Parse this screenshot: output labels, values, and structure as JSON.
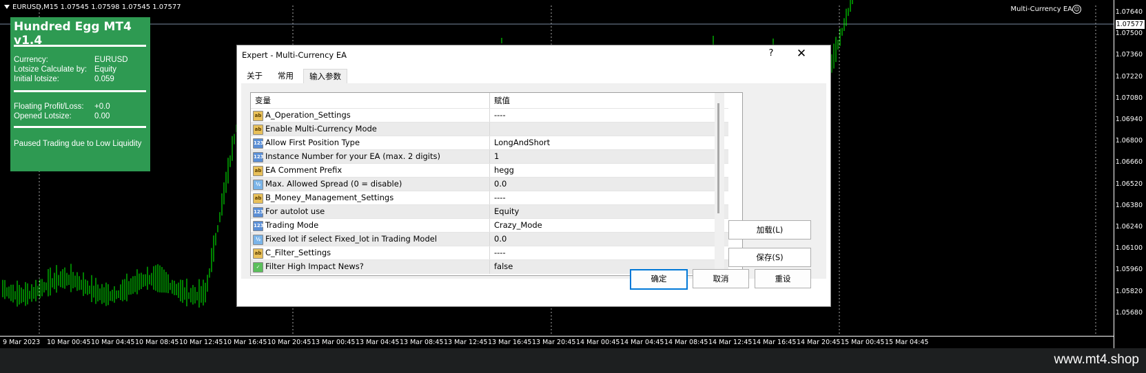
{
  "chart": {
    "symbol_line": "EURUSD,M15  1.07545 1.07598 1.07545 1.07577",
    "ea_name": "Multi-Currency EA",
    "smiley_icon": "☺",
    "price_ticks": [
      "1.07640",
      "1.07500",
      "1.07360",
      "1.07220",
      "1.07080",
      "1.06940",
      "1.06800",
      "1.06660",
      "1.06520",
      "1.06380",
      "1.06240",
      "1.06100",
      "1.05960",
      "1.05820",
      "1.05680"
    ],
    "current_price": "1.07577",
    "time_ticks": [
      "9 Mar 2023",
      "10 Mar 00:45",
      "10 Mar 04:45",
      "10 Mar 08:45",
      "10 Mar 12:45",
      "10 Mar 16:45",
      "10 Mar 20:45",
      "13 Mar 00:45",
      "13 Mar 04:45",
      "13 Mar 08:45",
      "13 Mar 12:45",
      "13 Mar 16:45",
      "13 Mar 20:45",
      "14 Mar 00:45",
      "14 Mar 04:45",
      "14 Mar 08:45",
      "14 Mar 12:45",
      "14 Mar 16:45",
      "14 Mar 20:45",
      "15 Mar 00:45",
      "15 Mar 04:45"
    ],
    "candle_color": "#00ff00"
  },
  "info_panel": {
    "title": "Hundred Egg MT4 v1.4",
    "currency_label": "Currency:",
    "currency_value": "EURUSD",
    "lotsize_calc_label": "Lotsize Calculate by:",
    "lotsize_calc_value": "Equity",
    "initial_lotsize_label": "Initial lotsize:",
    "initial_lotsize_value": "0.059",
    "floating_pl_label": "Floating Profit/Loss:",
    "floating_pl_value": "+0.0",
    "opened_lotsize_label": "Opened Lotsize:",
    "opened_lotsize_value": "0.00",
    "status": "Paused Trading due to Low Liquidity",
    "background_color": "#2e9a52"
  },
  "dialog": {
    "title": "Expert - Multi-Currency EA",
    "help_label": "?",
    "close_label": "✕",
    "tabs": [
      {
        "label": "关于",
        "active": false
      },
      {
        "label": "常用",
        "active": false
      },
      {
        "label": "输入参数",
        "active": true
      }
    ],
    "columns": {
      "variable": "变量",
      "value": "赋值"
    },
    "params": [
      {
        "icon": "ab",
        "icon_text": "ab",
        "name": "A_Operation_Settings",
        "value": "----"
      },
      {
        "icon": "ab",
        "icon_text": "ab",
        "name": "Enable Multi-Currency Mode",
        "value": ""
      },
      {
        "icon": "num",
        "icon_text": "123",
        "name": "Allow First Position Type",
        "value": "LongAndShort"
      },
      {
        "icon": "num",
        "icon_text": "123",
        "name": "Instance Number for your EA (max. 2 digits)",
        "value": "1"
      },
      {
        "icon": "ab",
        "icon_text": "ab",
        "name": "EA Comment Prefix",
        "value": "hegg"
      },
      {
        "icon": "frac",
        "icon_text": "½",
        "name": "Max. Allowed Spread (0 = disable)",
        "value": "0.0"
      },
      {
        "icon": "ab",
        "icon_text": "ab",
        "name": "B_Money_Management_Settings",
        "value": "----"
      },
      {
        "icon": "num",
        "icon_text": "123",
        "name": "For autolot use",
        "value": "Equity"
      },
      {
        "icon": "num",
        "icon_text": "123",
        "name": "Trading Mode",
        "value": "Crazy_Mode"
      },
      {
        "icon": "frac",
        "icon_text": "½",
        "name": "Fixed lot if select Fixed_lot in Trading Model",
        "value": "0.0"
      },
      {
        "icon": "ab",
        "icon_text": "ab",
        "name": "C_Filter_Settings",
        "value": "----"
      },
      {
        "icon": "bool",
        "icon_text": "✓",
        "name": "Filter High Impact News?",
        "value": "false"
      }
    ],
    "load_button": "加载(L)",
    "save_button": "保存(S)",
    "ok_button": "确定",
    "cancel_button": "取消",
    "reset_button": "重设"
  },
  "footer": {
    "watermark": "www.mt4.shop"
  }
}
